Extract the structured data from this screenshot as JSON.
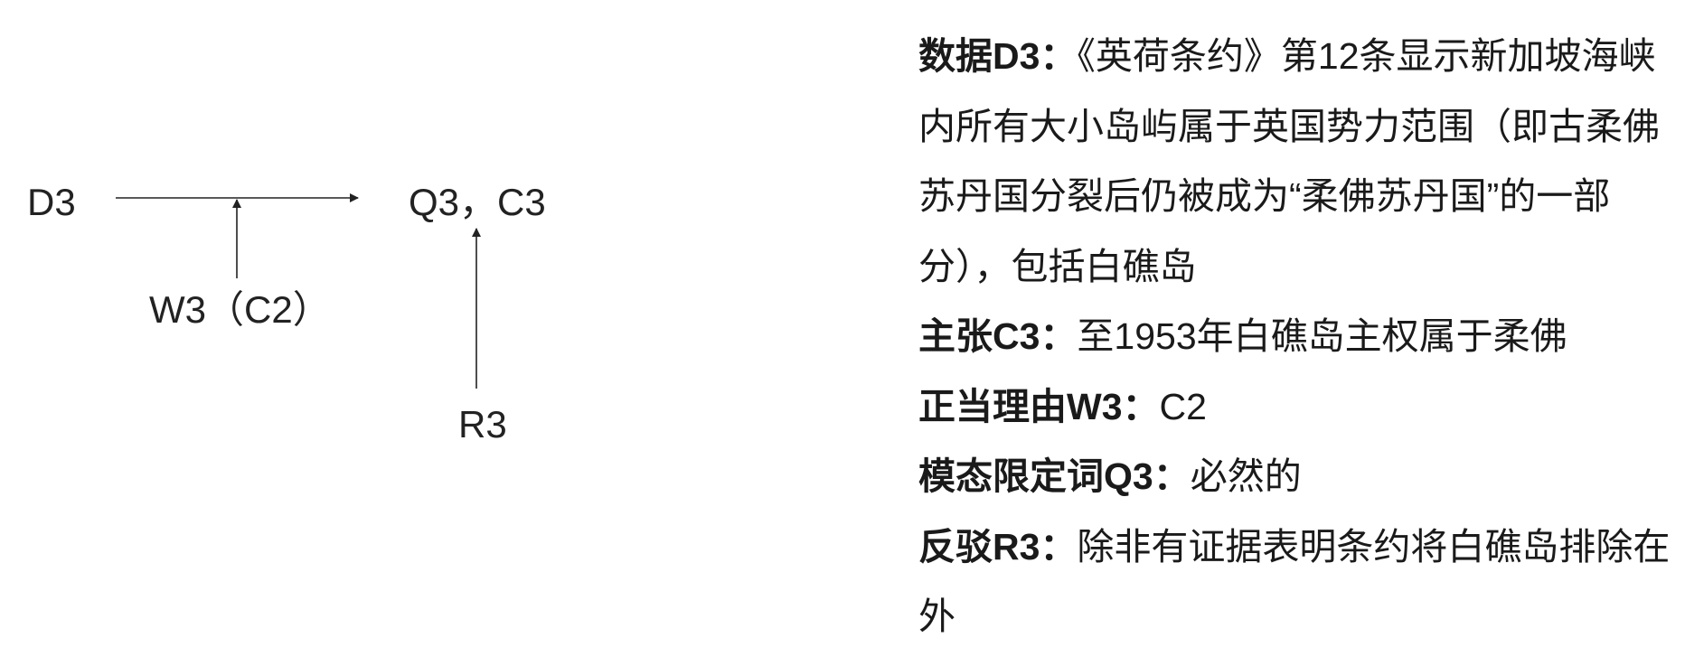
{
  "diagram": {
    "data_node": "D3",
    "claim_node": "Q3，C3",
    "warrant_node": "W3（C2）",
    "rebuttal_node": "R3"
  },
  "explanation": {
    "data": {
      "label": "数据D3：",
      "text": "《英荷条约》第12条显示新加坡海峡内所有大小岛屿属于英国势力范围（即古柔佛苏丹国分裂后仍被成为“柔佛苏丹国”的一部分），包括白礁岛"
    },
    "claim": {
      "label": "主张C3：",
      "text": "至1953年白礁岛主权属于柔佛"
    },
    "warrant": {
      "label": "正当理由W3：",
      "text": "C2"
    },
    "qualifier": {
      "label": "模态限定词Q3：",
      "text": "必然的"
    },
    "rebuttal": {
      "label": "反驳R3：",
      "text": "除非有证据表明条约将白礁岛排除在外"
    }
  }
}
